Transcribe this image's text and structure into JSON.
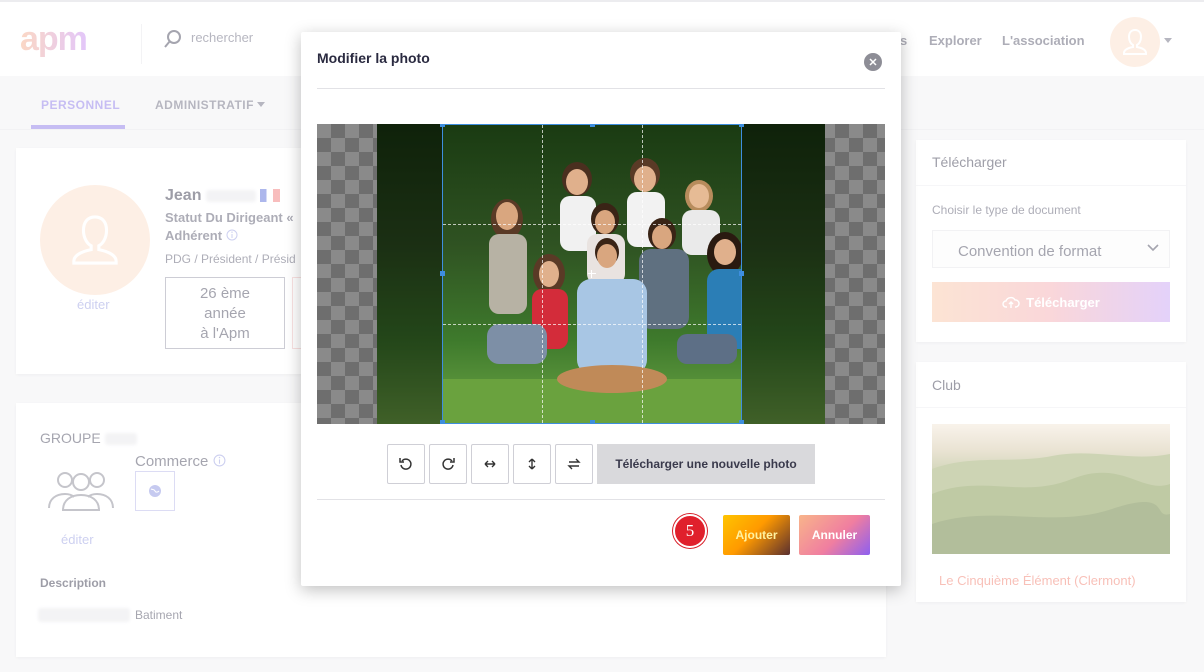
{
  "header": {
    "logo": "apm",
    "search_placeholder": "rechercher",
    "nav": [
      "s",
      "Explorer",
      "L'association"
    ]
  },
  "tabs": [
    {
      "label": "PERSONNEL"
    },
    {
      "label": "ADMINISTRATIF"
    }
  ],
  "profile": {
    "first_name": "Jean",
    "status": "Statut Du Dirigeant «",
    "member_type": "Adhérent",
    "roles": "PDG / Président / Présid",
    "edit_label": "éditer",
    "stat_line1": "26 ème",
    "stat_line2": "année",
    "stat_line3": "à l'Apm"
  },
  "group": {
    "title": "GROUPE",
    "sector": "Commerce",
    "edit_label": "éditer",
    "description_title": "Description",
    "description_value": "Batiment"
  },
  "download_card": {
    "title": "Télécharger",
    "select_label": "Choisir le type de document",
    "select_value": "Convention de format",
    "button_label": "Télécharger"
  },
  "club_card": {
    "title": "Club",
    "name": "Le Cinquième Élément (Clermont)"
  },
  "modal": {
    "title": "Modifier la photo",
    "upload_label": "Télécharger une nouvelle photo",
    "step_number": "5",
    "add_label": "Ajouter",
    "cancel_label": "Annuler"
  },
  "icons": [
    "search-icon",
    "user-icon",
    "flag-icon",
    "info-icon",
    "group-icon",
    "globe-icon",
    "close-icon",
    "rotate-left-icon",
    "rotate-right-icon",
    "flip-horizontal-icon",
    "flip-vertical-icon",
    "swap-icon",
    "cloud-upload-icon",
    "chevron-down-icon"
  ],
  "colors": {
    "accent": "#8d7be6",
    "avatar_bg": "#fbdfcb",
    "crop_border": "#3e8ede",
    "step_badge": "#e0202c"
  }
}
